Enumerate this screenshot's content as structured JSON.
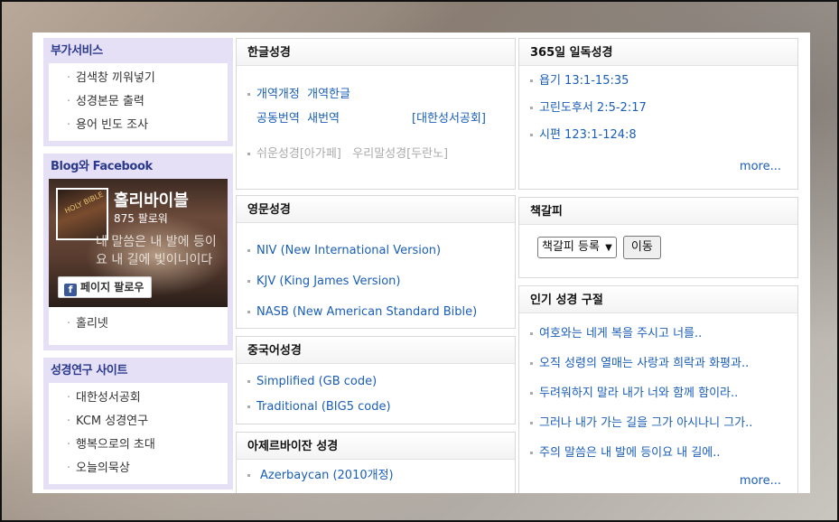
{
  "sidebar": {
    "extra_services": {
      "title": "부가서비스",
      "items": [
        "검색창 끼워넣기",
        "성경본문 출력",
        "용어 빈도 조사"
      ]
    },
    "blog_facebook": {
      "title": "Blog와 Facebook",
      "fb_name": "홀리바이블",
      "fb_followers": "875 팔로워",
      "fb_cover_text": "네 말씀은 내 발에 등이요 내 길에 빛이니이다",
      "fb_follow_label": "페이지 팔로우",
      "items": [
        "홀리넷"
      ]
    },
    "research_sites": {
      "title": "성경연구 사이트",
      "items": [
        "대한성서공회",
        "KCM 성경연구",
        "행복으로의 초대",
        "오늘의묵상"
      ]
    }
  },
  "korean_bible": {
    "title": "한글성경",
    "row1": [
      "개역개정",
      "개역한글"
    ],
    "row2": [
      "공동번역",
      "새번역"
    ],
    "row2_note": "[대한성서공회]",
    "row3": [
      "쉬운성경[아가페]",
      "우리말성경[두란노]"
    ]
  },
  "english_bible": {
    "title": "영문성경",
    "items": [
      "NIV (New International Version)",
      "KJV (King James Version)",
      "NASB (New American Standard Bible)"
    ]
  },
  "chinese_bible": {
    "title": "중국어성경",
    "items": [
      "Simplified (GB code)",
      "Traditional (BIG5 code)"
    ]
  },
  "azerbaijani_bible": {
    "title": "아제르바이잔 성경",
    "items": [
      "Azerbaycan (2010개정)"
    ]
  },
  "daily_reading": {
    "title": "365일 일독성경",
    "items": [
      "욥기 13:1-15:35",
      "고린도후서 2:5-2:17",
      "시편 123:1-124:8"
    ],
    "more": "more..."
  },
  "bookmark": {
    "title": "책갈피",
    "select_value": "책갈피 등록",
    "go_label": "이동"
  },
  "popular_verses": {
    "title": "인기 성경 구절",
    "items": [
      "여호와는 네게 복을 주시고 너를..",
      "오직 성령의 열매는 사랑과 희락과 화평과..",
      "두려워하지 말라 내가 너와 함께 함이라..",
      "그러나 내가 가는 길을 그가 아시나니 그가..",
      "주의 말씀은 내 발에 등이요 내 길에.."
    ],
    "more": "more..."
  }
}
